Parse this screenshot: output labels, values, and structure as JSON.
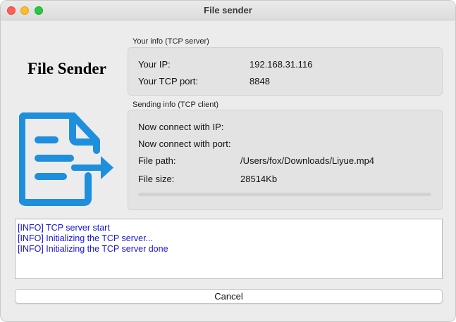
{
  "window": {
    "title": "File sender"
  },
  "header": {
    "app_title": "File Sender",
    "icon": "file-send-icon"
  },
  "server_info": {
    "group_label": "Your info (TCP server)",
    "ip_label": "Your IP:",
    "ip_value": "192.168.31.116",
    "port_label": "Your TCP port:",
    "port_value": "8848"
  },
  "sending_info": {
    "group_label": "Sending info (TCP client)",
    "connect_ip_label": "Now connect with IP:",
    "connect_ip_value": "",
    "connect_port_label": "Now connect with port:",
    "connect_port_value": "",
    "file_path_label": "File path:",
    "file_path_value": "/Users/fox/Downloads/Liyue.mp4",
    "file_size_label": "File size:",
    "file_size_value": "28514Kb",
    "progress": 0
  },
  "log": {
    "lines": [
      "[INFO] TCP server start",
      "[INFO] Initializing the TCP server...",
      "[INFO] Initializing the TCP server done"
    ]
  },
  "actions": {
    "cancel_label": "Cancel"
  },
  "colors": {
    "icon_blue": "#1d8fdc",
    "log_text": "#1414e0"
  }
}
